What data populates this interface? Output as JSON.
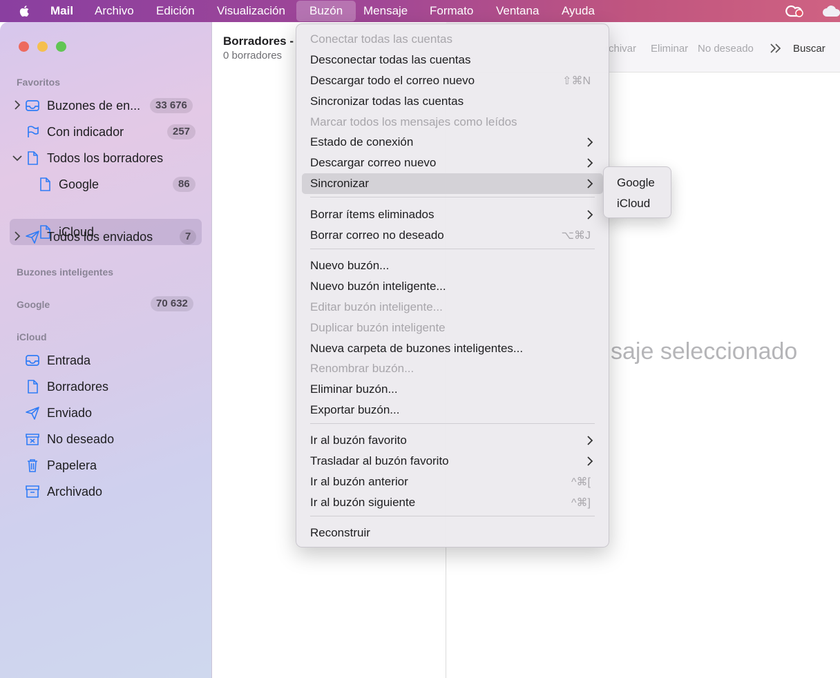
{
  "menubar": {
    "app": "Mail",
    "items": [
      "Archivo",
      "Edición",
      "Visualización",
      "Buzón",
      "Mensaje",
      "Formato",
      "Ventana",
      "Ayuda"
    ],
    "active": "Buzón"
  },
  "window_controls": {
    "close": "#ed6a5e",
    "minimize": "#f5bf4f",
    "zoom": "#61c554"
  },
  "sidebar": {
    "favorites_title": "Favoritos",
    "favorites": [
      {
        "label": "Buzones de en...",
        "count": "33 676",
        "icon": "inbox-icon",
        "chevron": "right"
      },
      {
        "label": "Con indicador",
        "count": "257",
        "icon": "flag-icon"
      },
      {
        "label": "Todos los borradores",
        "icon": "document-icon",
        "chevron": "down"
      },
      {
        "label": "Google",
        "count": "86",
        "icon": "document-icon"
      },
      {
        "label": "iCloud",
        "icon": "document-icon",
        "selected": true
      },
      {
        "label": "Todos los enviados",
        "count": "7",
        "icon": "paperplane-icon",
        "chevron": "right"
      }
    ],
    "smart_title": "Buzones inteligentes",
    "google_title": "Google",
    "google_count": "70 632",
    "icloud_title": "iCloud",
    "icloud": [
      {
        "label": "Entrada",
        "icon": "inbox-icon"
      },
      {
        "label": "Borradores",
        "icon": "document-icon"
      },
      {
        "label": "Enviado",
        "icon": "paperplane-icon"
      },
      {
        "label": "No deseado",
        "icon": "junk-icon"
      },
      {
        "label": "Papelera",
        "icon": "trash-icon"
      },
      {
        "label": "Archivado",
        "icon": "archive-icon"
      }
    ]
  },
  "list": {
    "title": "Borradores -",
    "subtitle": "0 borradores"
  },
  "toolbar": {
    "archive": "rchivar",
    "delete": "Eliminar",
    "junk": "No deseado",
    "search": "Buscar"
  },
  "viewer": {
    "message": "saje seleccionado"
  },
  "menu": {
    "items": [
      {
        "label": "Conectar todas las cuentas",
        "disabled": true
      },
      {
        "label": "Desconectar todas las cuentas"
      },
      {
        "label": "Descargar todo el correo nuevo",
        "shortcut": "⇧⌘N"
      },
      {
        "label": "Sincronizar todas las cuentas"
      },
      {
        "label": "Marcar todos los mensajes como leídos",
        "disabled": true
      },
      {
        "label": "Estado de conexión",
        "submenu": true
      },
      {
        "label": "Descargar correo nuevo",
        "submenu": true
      },
      {
        "label": "Sincronizar",
        "submenu": true,
        "highlighted": true
      },
      {
        "label": "Borrar ítems eliminados",
        "submenu": true
      },
      {
        "label": "Borrar correo no deseado",
        "shortcut": "⌥⌘J"
      },
      {
        "label": "Nuevo buzón..."
      },
      {
        "label": "Nuevo buzón inteligente..."
      },
      {
        "label": "Editar buzón inteligente...",
        "disabled": true
      },
      {
        "label": "Duplicar buzón inteligente",
        "disabled": true
      },
      {
        "label": "Nueva carpeta de buzones inteligentes..."
      },
      {
        "label": "Renombrar buzón...",
        "disabled": true
      },
      {
        "label": "Eliminar buzón..."
      },
      {
        "label": "Exportar buzón..."
      },
      {
        "label": "Ir al buzón favorito",
        "submenu": true
      },
      {
        "label": "Trasladar al buzón favorito",
        "submenu": true
      },
      {
        "label": "Ir al buzón anterior",
        "shortcut": "^⌘["
      },
      {
        "label": "Ir al buzón siguiente",
        "shortcut": "^⌘]"
      },
      {
        "label": "Reconstruir"
      }
    ],
    "submenu": [
      "Google",
      "iCloud"
    ]
  }
}
